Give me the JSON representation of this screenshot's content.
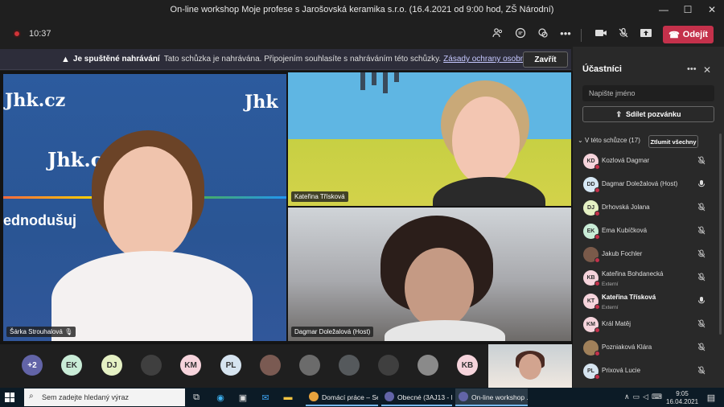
{
  "window": {
    "title": "On-line workshop Moje profese s Jarošovská keramika s.r.o. (16.4.2021 od 9:00 hod, ZŠ Národní)",
    "minimize": "—",
    "maximize": "☐",
    "close": "✕"
  },
  "toolbar": {
    "timer": "10:37",
    "leave_label": "Odejít",
    "icons": [
      "people-icon",
      "chat-icon",
      "reactions-icon",
      "more-icon"
    ],
    "controls": [
      "camera-icon",
      "mic-off-icon",
      "share-screen-icon"
    ]
  },
  "banner": {
    "bold": "Je spuštěné nahrávání",
    "text": "Tato schůzka je nahrávána. Připojením souhlasíte s nahráváním této schůzky.",
    "link": "Zásady ochrany osobních údajů",
    "close_label": "Zavřít"
  },
  "stage": {
    "tiles": [
      {
        "name": "Šárka Strouhalová"
      },
      {
        "name": "Kateřina Třísková"
      },
      {
        "name": "Dagmar Doležalová (Host)"
      }
    ],
    "backdrop_text_1": "Jhk.cz",
    "backdrop_text_2": "ednodušuj"
  },
  "bottom_bar": {
    "overflow": "+2",
    "avatars": [
      {
        "type": "text",
        "initials": "EK",
        "color": "#c9ecd7"
      },
      {
        "type": "text",
        "initials": "DJ",
        "color": "#e5f1c4"
      },
      {
        "type": "photo",
        "initials": ""
      },
      {
        "type": "text",
        "initials": "KM",
        "color": "#f6d4dc"
      },
      {
        "type": "text",
        "initials": "PL",
        "color": "#d6e4f0"
      },
      {
        "type": "photo",
        "initials": ""
      },
      {
        "type": "photo",
        "initials": ""
      },
      {
        "type": "photo",
        "initials": ""
      },
      {
        "type": "photo",
        "initials": ""
      },
      {
        "type": "photo",
        "initials": ""
      },
      {
        "type": "text",
        "initials": "KB",
        "color": "#f6d4dc"
      }
    ]
  },
  "panel": {
    "title": "Účastníci",
    "search_placeholder": "Napište jméno",
    "share_label": "Sdílet pozvánku",
    "section": "V této schůzce (17)",
    "mute_all": "Ztlumit všechny",
    "participants": [
      {
        "initials": "KD",
        "name": "Kozlová Dagmar",
        "sub": "",
        "color": "#f6d4dc",
        "mic": "off"
      },
      {
        "initials": "DD",
        "name": "Dagmar Doležalová (Host)",
        "sub": "",
        "color": "#d6e8f5",
        "mic": "on"
      },
      {
        "initials": "DJ",
        "name": "Drhovská Jolana",
        "sub": "",
        "color": "#e5f1c4",
        "mic": "off"
      },
      {
        "initials": "EK",
        "name": "Ema Kubíčková",
        "sub": "",
        "color": "#c9ecd7",
        "mic": "off"
      },
      {
        "initials": "",
        "name": "Jakub Fochler",
        "sub": "",
        "color": "#7a5a4a",
        "mic": "off"
      },
      {
        "initials": "KB",
        "name": "Kateřina Bohdanecká",
        "sub": "Externí",
        "color": "#f6d4dc",
        "mic": "off"
      },
      {
        "initials": "KT",
        "name": "Kateřina Třísková",
        "sub": "Externí",
        "color": "#f6d4dc",
        "mic": "on",
        "bold": true
      },
      {
        "initials": "KM",
        "name": "Král Matěj",
        "sub": "",
        "color": "#f6d4dc",
        "mic": "off"
      },
      {
        "initials": "",
        "name": "Pozniaková Klára",
        "sub": "",
        "color": "#a0805a",
        "mic": "off"
      },
      {
        "initials": "PL",
        "name": "Prixová Lucie",
        "sub": "",
        "color": "#d6e4f0",
        "mic": "off"
      }
    ]
  },
  "taskbar": {
    "search_placeholder": "Sem zadejte hledaný výraz",
    "apps": [
      {
        "label": "Domácí práce – Se...",
        "color": "#e8a33d"
      },
      {
        "label": "Obecné (3AJ13 - K...",
        "color": "#6264a7"
      },
      {
        "label": "On-line workshop ...",
        "color": "#6264a7"
      }
    ],
    "time": "9:05",
    "date": "16.04.2021"
  }
}
